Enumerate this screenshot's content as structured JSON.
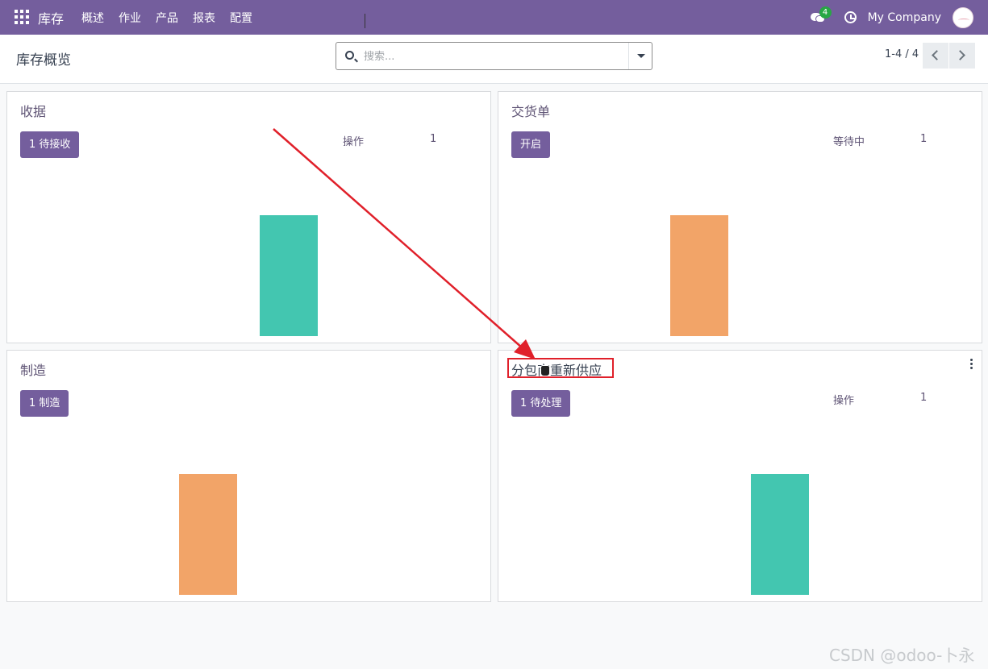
{
  "navbar": {
    "app_name": "库存",
    "menu": [
      "概述",
      "作业",
      "产品",
      "报表",
      "配置"
    ],
    "chat_count": "4",
    "company": "My Company"
  },
  "control_panel": {
    "breadcrumb": "库存概览",
    "search_placeholder": "搜索...",
    "pager": "1-4 / 4"
  },
  "cards": [
    {
      "title": "收据",
      "button": "1 待接收",
      "stat_label": "操作",
      "stat_value": "1",
      "bar_color": "#43c6b0"
    },
    {
      "title": "交货单",
      "button": "开启",
      "stat_label": "等待中",
      "stat_value": "1",
      "bar_color": "#f2a468"
    },
    {
      "title": "制造",
      "button": "1 制造",
      "stat_label": "",
      "stat_value": "",
      "bar_color": "#f2a468"
    },
    {
      "title": "分包商重新供应",
      "button": "1 待处理",
      "stat_label": "操作",
      "stat_value": "1",
      "bar_color": "#43c6b0"
    }
  ],
  "colors": {
    "accent": "#745e9d",
    "highlight": "#e0202a"
  },
  "watermark": "CSDN @odoo-卜永"
}
